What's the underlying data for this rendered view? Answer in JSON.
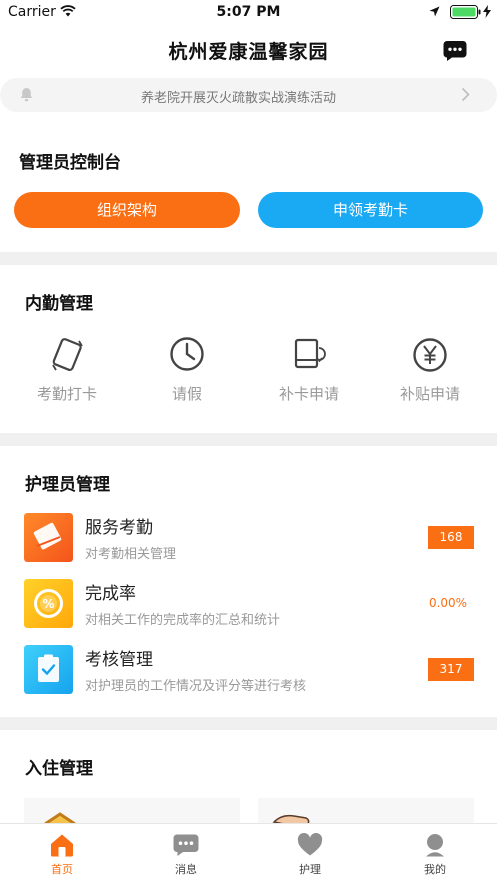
{
  "status_bar": {
    "carrier": "Carrier",
    "time": "5:07 PM"
  },
  "nav": {
    "title": "杭州爱康温馨家园"
  },
  "notice": {
    "text": "养老院开展灭火疏散实战演练活动"
  },
  "admin": {
    "title": "管理员控制台",
    "buttons": [
      {
        "label": "组织架构",
        "color": "#fa6f13"
      },
      {
        "label": "申领考勤卡",
        "color": "#1aa9f3"
      }
    ]
  },
  "attendance": {
    "title": "内勤管理",
    "items": [
      {
        "label": "考勤打卡",
        "icon": "punch-card-icon"
      },
      {
        "label": "请假",
        "icon": "clock-icon"
      },
      {
        "label": "补卡申请",
        "icon": "card-replace-icon"
      },
      {
        "label": "补贴申请",
        "icon": "yen-icon"
      }
    ]
  },
  "nurse": {
    "title": "护理员管理",
    "items": [
      {
        "title": "服务考勤",
        "subtitle": "对考勤相关管理",
        "badge": "168",
        "icon": "service-attendance-icon"
      },
      {
        "title": "完成率",
        "subtitle": "对相关工作的完成率的汇总和统计",
        "value": "0.00%",
        "icon": "completion-rate-icon"
      },
      {
        "title": "考核管理",
        "subtitle": "对护理员的工作情况及评分等进行考核",
        "badge": "317",
        "icon": "assessment-icon"
      }
    ]
  },
  "checkin": {
    "title": "入住管理"
  },
  "tabs": [
    {
      "label": "首页",
      "icon": "home-icon",
      "active": true
    },
    {
      "label": "消息",
      "icon": "message-icon",
      "active": false
    },
    {
      "label": "护理",
      "icon": "heart-icon",
      "active": false
    },
    {
      "label": "我的",
      "icon": "profile-icon",
      "active": false
    }
  ],
  "colors": {
    "accent": "#fa6f13",
    "blue": "#1aa9f3",
    "gray_text": "#999999"
  }
}
